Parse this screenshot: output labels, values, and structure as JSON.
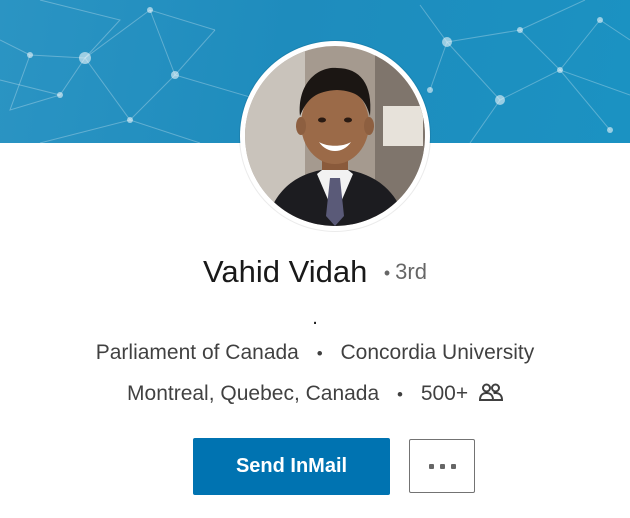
{
  "profile": {
    "name": "Vahid Vidah",
    "degree_bullet": "•",
    "degree": "3rd",
    "headline": ".",
    "organization": "Parliament of Canada",
    "school": "Concordia University",
    "location": "Montreal, Quebec, Canada",
    "connections": "500+",
    "separator": "•"
  },
  "actions": {
    "send_inmail_label": "Send InMail",
    "more_icon": "more-horizontal-icon"
  },
  "icons": {
    "connections_icon": "people-icon"
  },
  "colors": {
    "banner_accent": "#1e8cbd",
    "primary_button": "#0073b1",
    "text_primary": "#000000e6",
    "text_secondary": "#00000099"
  }
}
